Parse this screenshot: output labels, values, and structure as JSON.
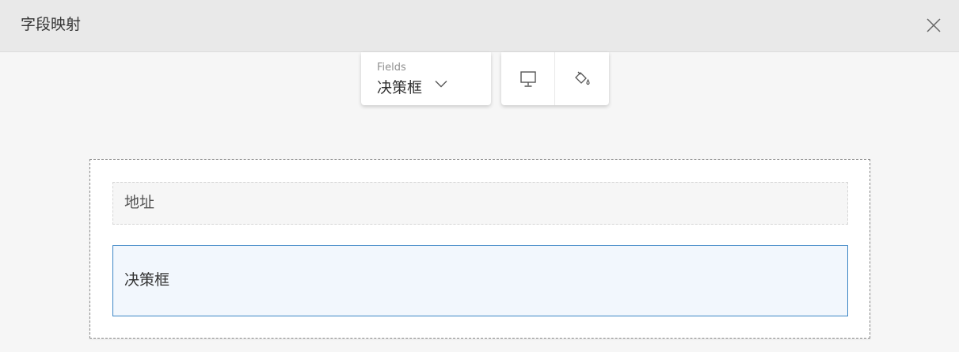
{
  "header": {
    "title": "字段映射",
    "close_icon": "close-icon"
  },
  "fields_selector": {
    "caption": "Fields",
    "value": "决策框",
    "chevron_icon": "chevron-down-icon"
  },
  "toolbar": {
    "desktop_icon": "desktop-icon",
    "paint_icon": "paint-bucket-icon"
  },
  "form": {
    "fields": [
      {
        "label": "地址",
        "selected": false
      },
      {
        "label": "决策框",
        "selected": true
      }
    ]
  },
  "colors": {
    "accent": "#3d86c6",
    "selected_bg": "#f2f7fd",
    "header_bg": "#e9e9e9",
    "page_bg": "#f6f6f6"
  }
}
